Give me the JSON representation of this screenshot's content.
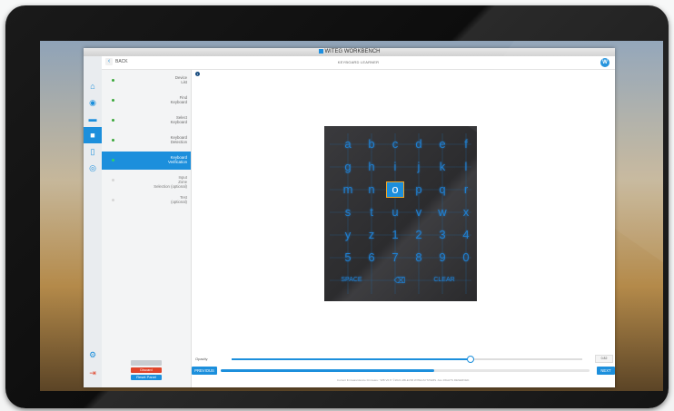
{
  "app": {
    "window_title": "WITEG WORKBENCH",
    "back_label": "BACK",
    "page_title": "KEYBOARD LEARNER",
    "brand_letter": "W"
  },
  "iconbar": [
    {
      "name": "home-icon",
      "glyph": "⌂"
    },
    {
      "name": "target-icon",
      "glyph": "◉"
    },
    {
      "name": "clapper-icon",
      "glyph": "▬"
    },
    {
      "name": "video-camera-icon",
      "glyph": "■",
      "active": true
    },
    {
      "name": "phone-icon",
      "glyph": "▯"
    },
    {
      "name": "record-icon",
      "glyph": "◎"
    }
  ],
  "iconbar_bottom": [
    {
      "name": "settings-icon",
      "glyph": "⚙"
    },
    {
      "name": "logout-icon",
      "glyph": "⇥"
    }
  ],
  "steps": [
    {
      "label": "Device\nList",
      "state": "done"
    },
    {
      "label": "Find\nKeyboard",
      "state": "done"
    },
    {
      "label": "Select\nKeyboard",
      "state": "done"
    },
    {
      "label": "Keyboard\nDetection",
      "state": "done"
    },
    {
      "label": "Keyboard\nVerification",
      "state": "active"
    },
    {
      "label": "Input\nZone\nSelection (optional)",
      "state": "todo"
    },
    {
      "label": "Test\n(optional)",
      "state": "todo"
    }
  ],
  "sidebar_buttons": {
    "save": "",
    "discard": "Discard",
    "reset": "Reset Panel"
  },
  "colors": {
    "accent": "#1c8fdc",
    "discard": "#e0452b",
    "save_disabled": "#c9cdd1",
    "done": "#3aa83a"
  },
  "keyboard": {
    "rows": [
      [
        "a",
        "b",
        "c",
        "d",
        "e",
        "f"
      ],
      [
        "g",
        "h",
        "i",
        "j",
        "k",
        "l"
      ],
      [
        "m",
        "n",
        "o",
        "p",
        "q",
        "r"
      ],
      [
        "s",
        "t",
        "u",
        "v",
        "w",
        "x"
      ],
      [
        "y",
        "z",
        "1",
        "2",
        "3",
        "4"
      ],
      [
        "5",
        "6",
        "7",
        "8",
        "9",
        "0"
      ]
    ],
    "space_label": "SPACE",
    "clear_label": "CLEAR"
  },
  "opacity": {
    "label": "Opacity",
    "value_text": "0.82",
    "fraction": 0.68
  },
  "navigation": {
    "previous": "PREVIOUS",
    "next": "NEXT",
    "progress": 0.58
  },
  "footer_text": "Current firmware/device Firmware: \"WB V6.6\" ©2021 ABLEVIM WITEGSYSTEMS. ALL RIGHTS RESERVED."
}
